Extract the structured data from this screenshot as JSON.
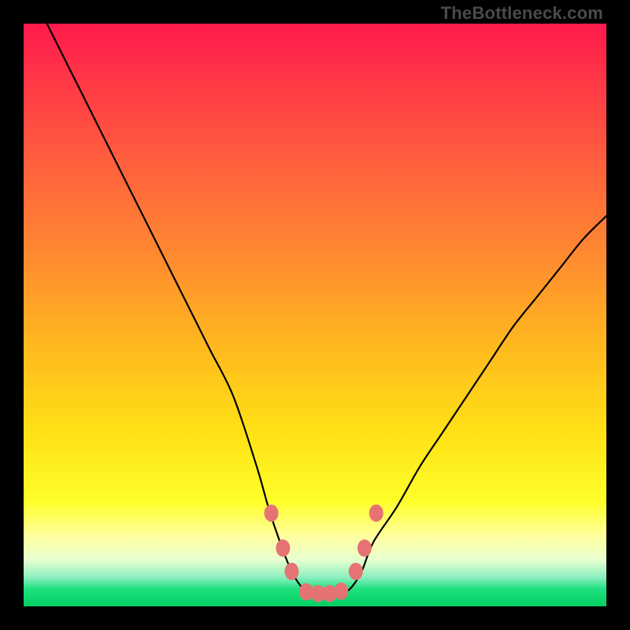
{
  "watermark": "TheBottleneck.com",
  "chart_data": {
    "type": "line",
    "title": "",
    "xlabel": "",
    "ylabel": "",
    "xlim": [
      0,
      100
    ],
    "ylim": [
      0,
      100
    ],
    "grid": false,
    "series": [
      {
        "name": "bottleneck-curve",
        "x": [
          4,
          8,
          12,
          16,
          20,
          24,
          28,
          32,
          36,
          40,
          42,
          44,
          46,
          48,
          50,
          52,
          54,
          56,
          58,
          60,
          64,
          68,
          72,
          76,
          80,
          84,
          88,
          92,
          96,
          100
        ],
        "y": [
          100,
          92,
          84,
          76,
          68,
          60,
          52,
          44,
          36,
          24,
          17,
          11,
          6,
          3,
          2,
          2,
          2,
          3,
          6,
          11,
          17,
          24,
          30,
          36,
          42,
          48,
          53,
          58,
          63,
          67
        ]
      }
    ],
    "markers": [
      {
        "name": "left-outer",
        "x": 42.5,
        "y": 16
      },
      {
        "name": "left-mid",
        "x": 44.5,
        "y": 10
      },
      {
        "name": "left-inner",
        "x": 46.0,
        "y": 6
      },
      {
        "name": "flat-1",
        "x": 48.5,
        "y": 2.5
      },
      {
        "name": "flat-2",
        "x": 50.5,
        "y": 2.2
      },
      {
        "name": "flat-3",
        "x": 52.5,
        "y": 2.2
      },
      {
        "name": "flat-4",
        "x": 54.5,
        "y": 2.6
      },
      {
        "name": "right-inner",
        "x": 57.0,
        "y": 6
      },
      {
        "name": "right-mid",
        "x": 58.5,
        "y": 10
      },
      {
        "name": "right-outer",
        "x": 60.5,
        "y": 16
      }
    ],
    "marker_color": "#e57373",
    "background_gradient": [
      "#ff1a4d",
      "#ffff2a",
      "#00d060"
    ]
  }
}
